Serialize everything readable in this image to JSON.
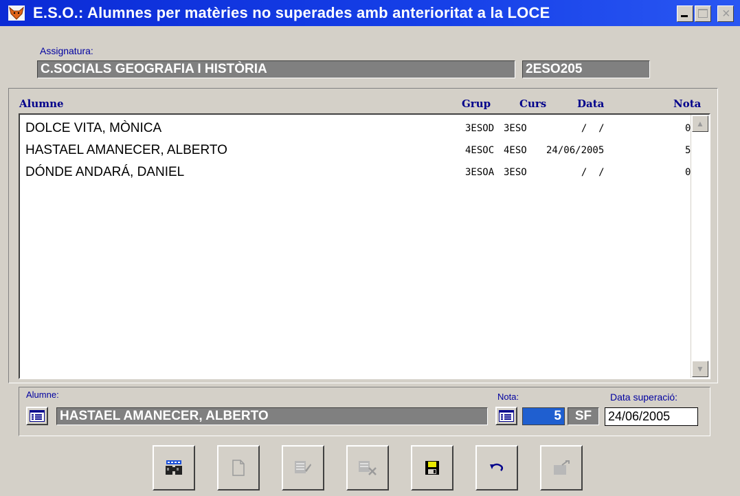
{
  "window": {
    "title": "E.S.O.: Alumnes per matèries no superades amb anterioritat a la LOCE",
    "min_glyph": "_",
    "max_glyph": "□",
    "close_glyph": "×"
  },
  "assignatura": {
    "label": "Assignatura:",
    "name": "C.SOCIALS GEOGRAFIA I HISTÒRIA",
    "code": "2ESO205"
  },
  "table": {
    "columns": [
      "Alumne",
      "Grup",
      "Curs",
      "Data",
      "Nota"
    ],
    "rows": [
      {
        "alumne": "DOLCE VITA, MÒNICA",
        "grup": "3ESOD",
        "curs": "3ESO",
        "data": "  /  /",
        "nota": "0"
      },
      {
        "alumne": "HASTAEL AMANECER, ALBERTO",
        "grup": "4ESOC",
        "curs": "4ESO",
        "data": "24/06/2005",
        "nota": "5"
      },
      {
        "alumne": "DÓNDE ANDARÁ, DANIEL",
        "grup": "3ESOA",
        "curs": "3ESO",
        "data": "  /  /",
        "nota": "0"
      }
    ]
  },
  "detail": {
    "alumne_label": "Alumne:",
    "alumne_value": "HASTAEL AMANECER, ALBERTO",
    "nota_label": "Nota:",
    "nota_value": "5",
    "qualificacio": "SF",
    "data_label": "Data superació:",
    "data_value": "24/06/2005"
  },
  "toolbar": [
    {
      "icon": "binoculars-icon",
      "enabled": true
    },
    {
      "icon": "new-document-icon",
      "enabled": false
    },
    {
      "icon": "edit-icon",
      "enabled": false
    },
    {
      "icon": "delete-icon",
      "enabled": false
    },
    {
      "icon": "save-floppy-icon",
      "enabled": true
    },
    {
      "icon": "undo-icon",
      "enabled": true
    },
    {
      "icon": "exit-icon",
      "enabled": false
    }
  ],
  "colors": {
    "titlebar": "#0b2bd6",
    "face": "#d4d0c8",
    "field_dark": "#808080",
    "label_blue": "#0000a0",
    "header_blue": "#00008b",
    "note_blue": "#1f5fd0"
  }
}
